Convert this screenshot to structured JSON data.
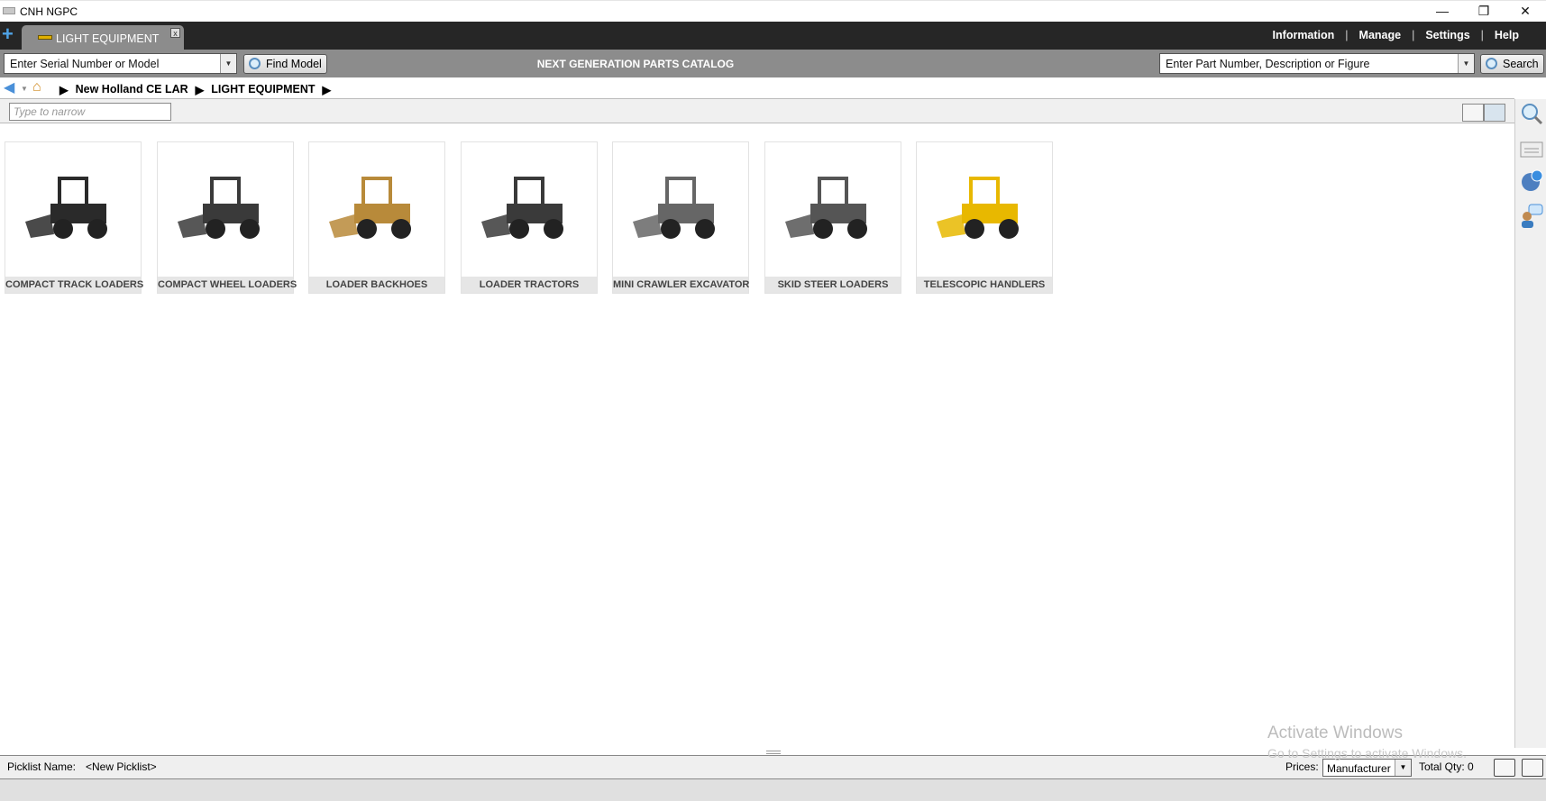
{
  "window": {
    "title": "CNH NGPC"
  },
  "tab": {
    "label": "LIGHT EQUIPMENT",
    "close": "x"
  },
  "top_nav": [
    "Information",
    "Manage",
    "Settings",
    "Help"
  ],
  "toolbar": {
    "serial_placeholder": "Enter Serial Number or Model",
    "find_model": "Find Model",
    "center_title": "NEXT GENERATION PARTS CATALOG",
    "part_placeholder": "Enter Part Number, Description or Figure",
    "search": "Search"
  },
  "breadcrumb": [
    "New Holland CE LAR",
    "LIGHT EQUIPMENT"
  ],
  "filter": {
    "placeholder": "Type to narrow"
  },
  "categories": [
    {
      "label": "COMPACT TRACK LOADERS",
      "color": "#2a2a2a"
    },
    {
      "label": "COMPACT WHEEL LOADERS",
      "color": "#3a3a3a"
    },
    {
      "label": "LOADER BACKHOES",
      "color": "#b88a3a"
    },
    {
      "label": "LOADER TRACTORS",
      "color": "#3a3a3a"
    },
    {
      "label": "MINI CRAWLER EXCAVATOR",
      "color": "#666666"
    },
    {
      "label": "SKID STEER LOADERS",
      "color": "#555555"
    },
    {
      "label": "TELESCOPIC HANDLERS",
      "color": "#e8b800"
    }
  ],
  "status": {
    "picklist_label": "Picklist Name:",
    "picklist_value": "<New Picklist>",
    "prices_label": "Prices:",
    "prices_value": "Manufacturer",
    "total_qty": "Total Qty: 0"
  },
  "watermark": {
    "line1": "Activate Windows",
    "line2": "Go to Settings to activate Windows."
  }
}
